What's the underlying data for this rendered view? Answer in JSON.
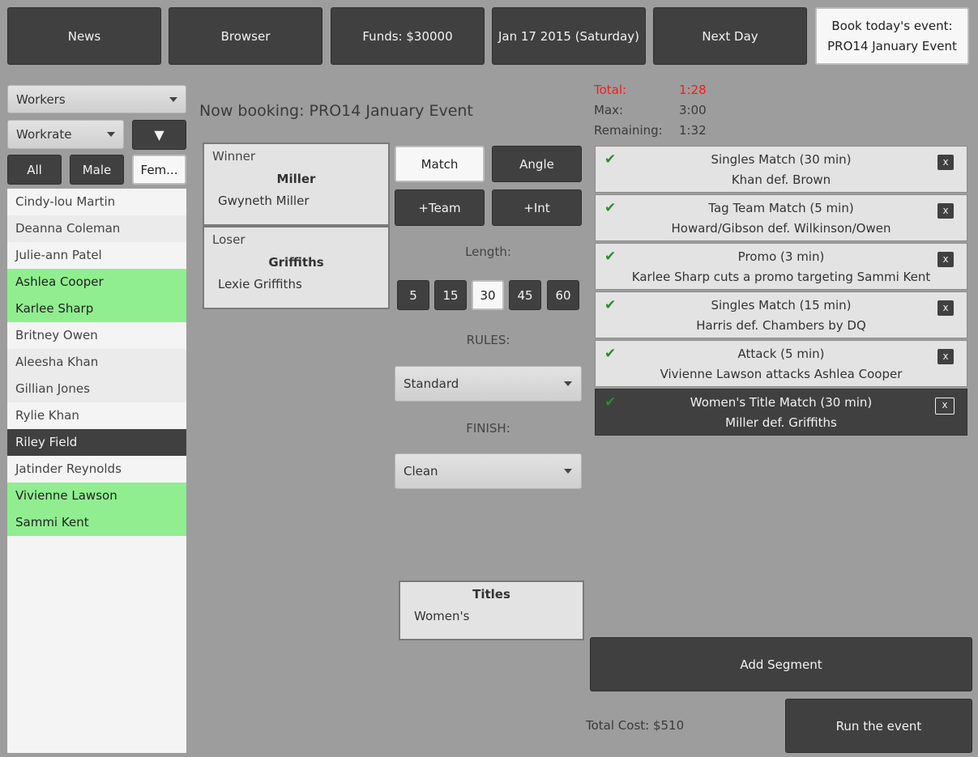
{
  "topbar": {
    "news": "News",
    "browser": "Browser",
    "funds": "Funds: $30000",
    "date": "Jan 17 2015 (Saturday)",
    "next_day": "Next Day",
    "book_line1": "Book today's event:",
    "book_line2": "PRO14 January Event"
  },
  "filters": {
    "category": "Workers",
    "sort": "Workrate",
    "sort_order_symbol": "▼",
    "all": "All",
    "male": "Male",
    "female": "Fem..."
  },
  "workers": [
    {
      "name": "Cindy-lou Martin",
      "style": "normal"
    },
    {
      "name": "Deanna Coleman",
      "style": "alt"
    },
    {
      "name": "Julie-ann Patel",
      "style": "normal"
    },
    {
      "name": "Ashlea Cooper",
      "style": "green"
    },
    {
      "name": "Karlee Sharp",
      "style": "green"
    },
    {
      "name": "Britney Owen",
      "style": "normal"
    },
    {
      "name": "Aleesha Khan",
      "style": "alt"
    },
    {
      "name": "Gillian Jones",
      "style": "alt"
    },
    {
      "name": "Rylie Khan",
      "style": "normal"
    },
    {
      "name": "Riley Field",
      "style": "selected"
    },
    {
      "name": "Jatinder Reynolds",
      "style": "normal"
    },
    {
      "name": "Vivienne Lawson",
      "style": "green"
    },
    {
      "name": "Sammi Kent",
      "style": "green"
    }
  ],
  "booking": {
    "heading": "Now booking: PRO14 January Event",
    "winner_label": "Winner",
    "winner_team": "Miller",
    "winner_name": "Gwyneth Miller",
    "loser_label": "Loser",
    "loser_team": "Griffiths",
    "loser_name": "Lexie Griffiths"
  },
  "segment_type": {
    "match": "Match",
    "angle": "Angle",
    "team": "+Team",
    "int": "+Int"
  },
  "length": {
    "label": "Length:",
    "options": [
      "5",
      "15",
      "30",
      "45",
      "60"
    ],
    "selected": "30"
  },
  "rules": {
    "label": "RULES:",
    "value": "Standard"
  },
  "finish": {
    "label": "FINISH:",
    "value": "Clean"
  },
  "titles": {
    "heading": "Titles",
    "item": "Women's"
  },
  "time": {
    "total_label": "Total:",
    "total_value": "1:28",
    "max_label": "Max:",
    "max_value": "3:00",
    "remaining_label": "Remaining:",
    "remaining_value": "1:32",
    "total_color": "#e82020"
  },
  "segments": [
    {
      "title": "Singles Match (30 min)",
      "result": "Khan def. Brown"
    },
    {
      "title": "Tag Team Match (5 min)",
      "result": "Howard/Gibson def. Wilkinson/Owen"
    },
    {
      "title": "Promo (3 min)",
      "result": "Karlee Sharp cuts a promo targeting Sammi Kent"
    },
    {
      "title": "Singles Match (15 min)",
      "result": "Harris def. Chambers by DQ"
    },
    {
      "title": "Attack (5 min)",
      "result": "Vivienne Lawson attacks Ashlea Cooper"
    },
    {
      "title": "Women's Title Match (30 min)",
      "result": "Miller def. Griffiths"
    }
  ],
  "segment_check": "✔",
  "segment_remove": "x",
  "actions": {
    "add_segment": "Add Segment",
    "total_cost": "Total Cost: $510",
    "run_event": "Run the event"
  }
}
